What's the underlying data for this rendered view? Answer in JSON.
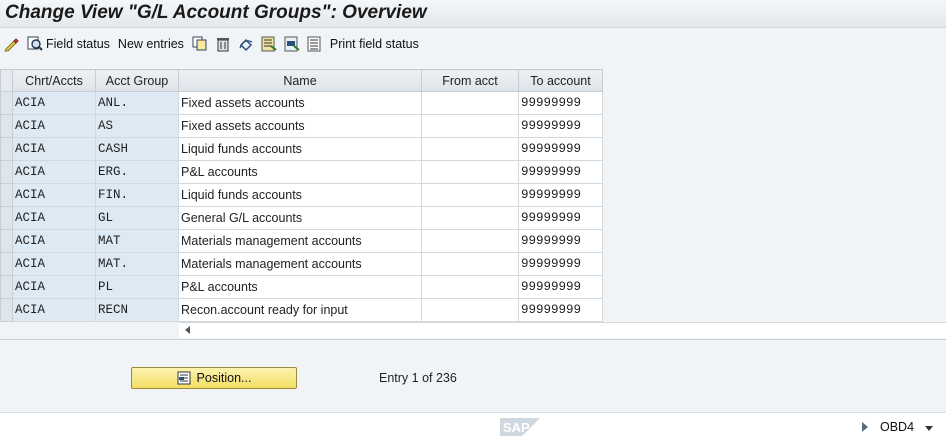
{
  "title": "Change View \"G/L Account Groups\": Overview",
  "toolbar": {
    "field_status_label": "Field status",
    "new_entries_label": "New entries",
    "print_field_status_label": "Print field status"
  },
  "table": {
    "columns": [
      "Chrt/Accts",
      "Acct Group",
      "Name",
      "From acct",
      "To account"
    ],
    "rows": [
      {
        "chart": "ACIA",
        "group": "ANL.",
        "name": "Fixed assets accounts",
        "from": "",
        "to": "99999999"
      },
      {
        "chart": "ACIA",
        "group": "AS",
        "name": "Fixed assets accounts",
        "from": "",
        "to": "99999999"
      },
      {
        "chart": "ACIA",
        "group": "CASH",
        "name": "Liquid funds accounts",
        "from": "",
        "to": "99999999"
      },
      {
        "chart": "ACIA",
        "group": "ERG.",
        "name": "P&L accounts",
        "from": "",
        "to": "99999999"
      },
      {
        "chart": "ACIA",
        "group": "FIN.",
        "name": "Liquid funds accounts",
        "from": "",
        "to": "99999999"
      },
      {
        "chart": "ACIA",
        "group": "GL",
        "name": "General G/L accounts",
        "from": "",
        "to": "99999999"
      },
      {
        "chart": "ACIA",
        "group": "MAT",
        "name": "Materials management accounts",
        "from": "",
        "to": "99999999"
      },
      {
        "chart": "ACIA",
        "group": "MAT.",
        "name": "Materials management accounts",
        "from": "",
        "to": "99999999"
      },
      {
        "chart": "ACIA",
        "group": "PL",
        "name": "P&L accounts",
        "from": "",
        "to": "99999999"
      },
      {
        "chart": "ACIA",
        "group": "RECN",
        "name": "Recon.account ready for input",
        "from": "",
        "to": "99999999"
      }
    ]
  },
  "footer": {
    "position_label": "Position...",
    "entry_info": "Entry 1 of 236"
  },
  "status": {
    "logo_text": "SAP",
    "system": "OBD4"
  },
  "colors": {
    "key_column_bg": "#dde9f3",
    "position_button": "#f3de63",
    "title_text": "#1a1a1a"
  }
}
